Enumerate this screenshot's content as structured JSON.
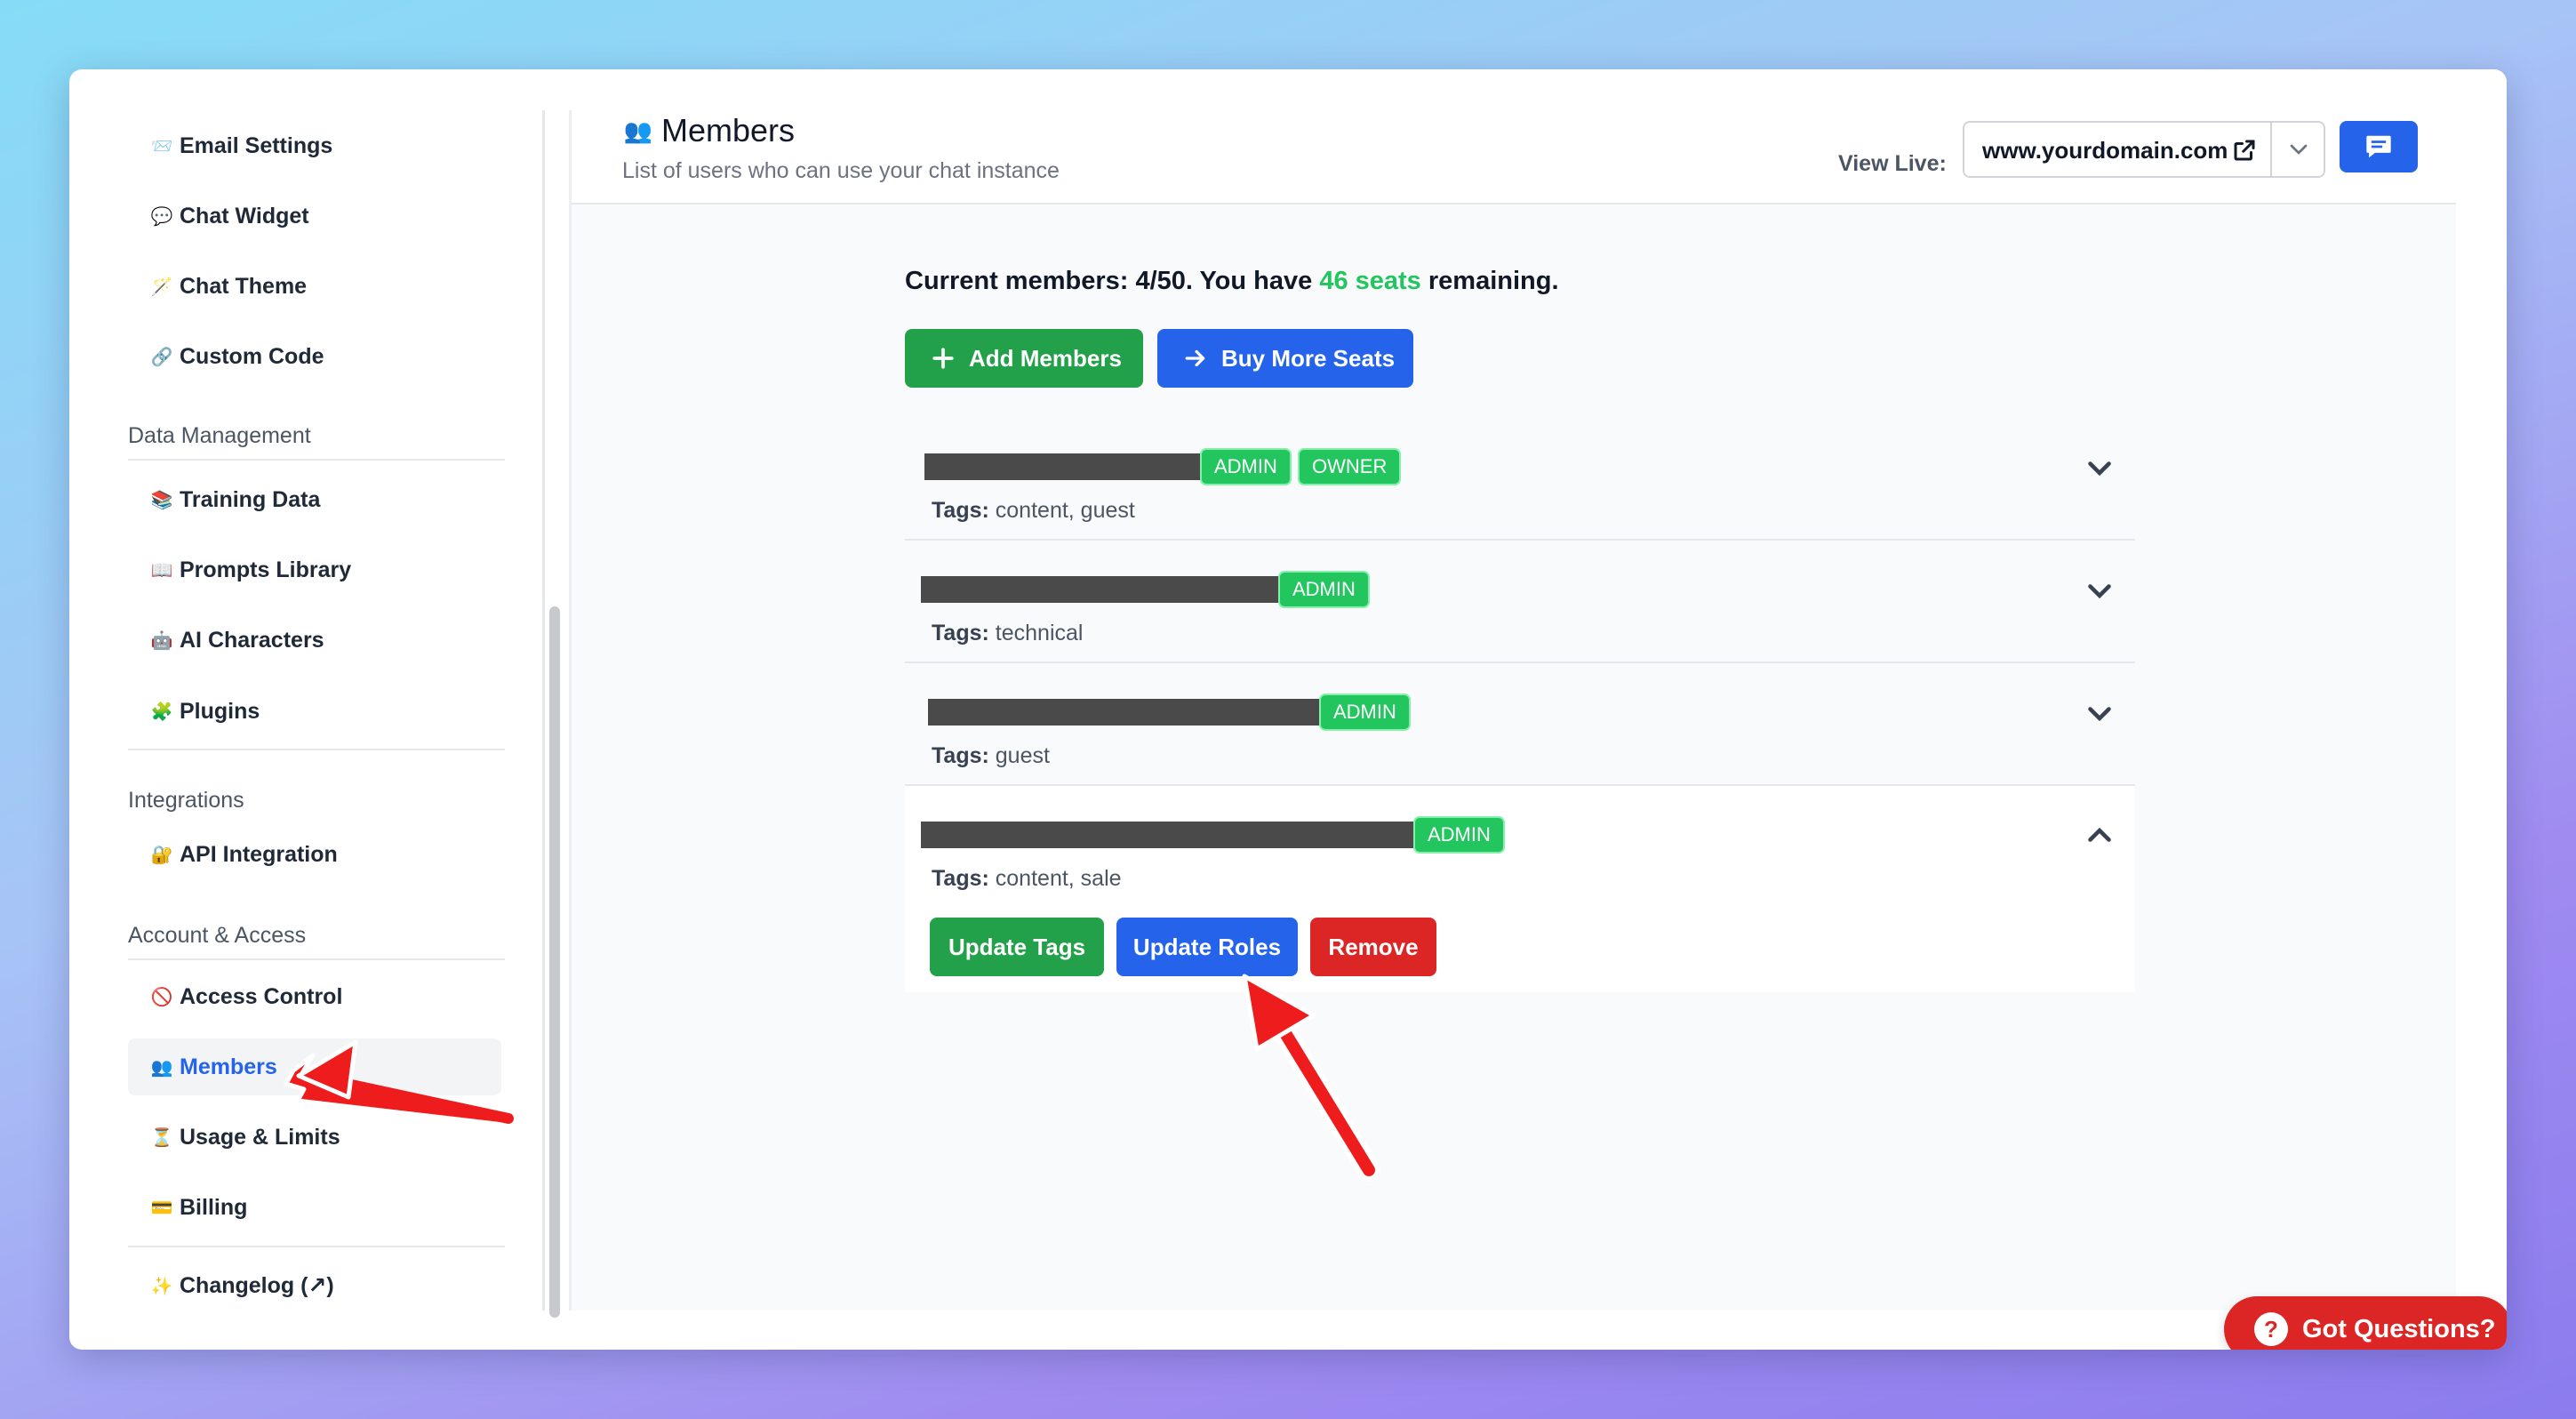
{
  "sidebar": {
    "items_top": [
      {
        "icon": "📨",
        "label": "Email Settings"
      },
      {
        "icon": "💬",
        "label": "Chat Widget"
      },
      {
        "icon": "🪄",
        "label": "Chat Theme"
      },
      {
        "icon": "🔗",
        "label": "Custom Code"
      }
    ],
    "data_management": {
      "label": "Data Management",
      "items": [
        {
          "icon": "📚",
          "label": "Training Data"
        },
        {
          "icon": "📖",
          "label": "Prompts Library"
        },
        {
          "icon": "🤖",
          "label": "AI Characters"
        },
        {
          "icon": "🧩",
          "label": "Plugins"
        }
      ]
    },
    "integrations": {
      "label": "Integrations",
      "items": [
        {
          "icon": "🔐",
          "label": "API Integration"
        }
      ]
    },
    "account_access": {
      "label": "Account & Access",
      "items": [
        {
          "icon": "🚫",
          "label": "Access Control"
        },
        {
          "icon": "👥",
          "label": "Members"
        },
        {
          "icon": "⏳",
          "label": "Usage & Limits"
        },
        {
          "icon": "💳",
          "label": "Billing"
        }
      ]
    },
    "changelog": {
      "icon": "✨",
      "label": "Changelog (↗)"
    }
  },
  "header": {
    "icon": "👥",
    "title": "Members",
    "subtitle": "List of users who can use your chat instance",
    "view_live_label": "View Live:",
    "domain": "www.yourdomain.com"
  },
  "summary": {
    "prefix": "Current members: 4/50. You have ",
    "seats": "46 seats",
    "suffix": " remaining."
  },
  "actions": {
    "add_members": "Add Members",
    "buy_more_seats": "Buy More Seats"
  },
  "members": [
    {
      "badges": [
        "ADMIN",
        "OWNER"
      ],
      "tags_label": "Tags:",
      "tags": "content, guest"
    },
    {
      "badges": [
        "ADMIN"
      ],
      "tags_label": "Tags:",
      "tags": "technical"
    },
    {
      "badges": [
        "ADMIN"
      ],
      "tags_label": "Tags:",
      "tags": "guest"
    },
    {
      "badges": [
        "ADMIN"
      ],
      "tags_label": "Tags:",
      "tags": "content, sale"
    }
  ],
  "member_actions": {
    "update_tags": "Update Tags",
    "update_roles": "Update Roles",
    "remove": "Remove"
  },
  "help": {
    "icon": "?",
    "label": "Got Questions?"
  },
  "colors": {
    "primary": "#2563eb",
    "success": "#22a04a",
    "danger": "#dc2626",
    "seats_green": "#22c55e",
    "annotation_arrow": "#ee1c1c"
  }
}
